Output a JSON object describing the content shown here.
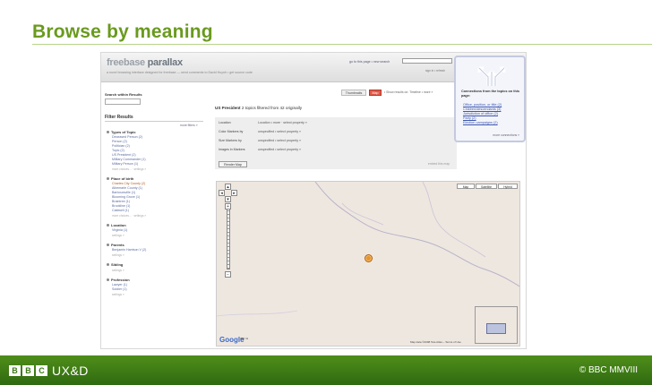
{
  "slide": {
    "title": "Browse by meaning"
  },
  "app": {
    "logo_light": "freebase ",
    "logo_bold": "parallax",
    "tagline": "a novel browsing interface designed for freebase — send comments to David Huynh • get source code",
    "toplinks": "go to this page • new search",
    "userlinks": "sign in • refresh",
    "left_search_label": "Search within Results",
    "filter_results_title": "Filter Results",
    "more_filters": "more filters »",
    "filter_groups": [
      {
        "title": "Types of Topic",
        "items": [
          {
            "label": "Deceased Person (2)",
            "active": false
          },
          {
            "label": "Person (2)",
            "active": false
          },
          {
            "label": "Politician (2)",
            "active": false
          },
          {
            "label": "Topic (2)",
            "active": false
          },
          {
            "label": "US President (2)",
            "active": false
          },
          {
            "label": "Military Commander (1)",
            "active": false
          },
          {
            "label": "Military Person (1)",
            "active": false
          }
        ],
        "more": "more choices... · settings »"
      },
      {
        "title": "Place of birth",
        "items": [
          {
            "label": "Charles City County (2)",
            "active": true
          },
          {
            "label": "Albemarle County (1)",
            "active": false
          },
          {
            "label": "Barboursville (1)",
            "active": false
          },
          {
            "label": "Blooming Grove (1)",
            "active": false
          },
          {
            "label": "Braintree (1)",
            "active": false
          },
          {
            "label": "Brookline (1)",
            "active": false
          },
          {
            "label": "Caldwell (1)",
            "active": false
          }
        ],
        "more": "more choices... · settings »"
      },
      {
        "title": "Location",
        "items": [
          {
            "label": "Virginia (1)",
            "active": false
          }
        ],
        "more": "settings »"
      },
      {
        "title": "Parents",
        "items": [
          {
            "label": "Benjamin Harrison V (2)",
            "active": false
          }
        ],
        "more": "settings »"
      },
      {
        "title": "Sibling",
        "items": [],
        "more": "settings »"
      },
      {
        "title": "Profession",
        "items": [
          {
            "label": "Lawyer (1)",
            "active": false
          },
          {
            "label": "Soldier (1)",
            "active": false
          }
        ],
        "more": "settings »"
      }
    ],
    "view_tabs": {
      "thumbnails": "Thumbnails",
      "map": "Map"
    },
    "show_results_on": "• Show results on: Timeline • more »",
    "query": {
      "name": "US President",
      "rest": "  2 topics filtered from 42 originally"
    },
    "props": [
      {
        "label": "Location",
        "value": "Location • more · select property »"
      },
      {
        "label": "Color Markers by",
        "value": "unspecified • select property »"
      },
      {
        "label": "Size Markers by",
        "value": "unspecified • select property »"
      },
      {
        "label": "Images in Markers",
        "value": "unspecified • select property »"
      }
    ],
    "render_map": "Render Map",
    "embed_map": "embed this map",
    "map_types": {
      "map": "Map",
      "satellite": "Satellite",
      "hybrid": "Hybrid"
    },
    "google": "Google",
    "scale_text": "200 mi",
    "map_credit": "Map data ©2008 Tele Atlas – Terms of Use",
    "connections": {
      "title": "Connections from the topics on this page:",
      "items": [
        "Office, position, or title (2)",
        "Children/descendants (3)",
        "Jurisdiction of office (2)",
        "Party (2)",
        "Election campaigns (2)"
      ],
      "more": "more connections »"
    }
  },
  "footer": {
    "uxd": "UX&D",
    "copyright": "© BBC MMVIII"
  }
}
